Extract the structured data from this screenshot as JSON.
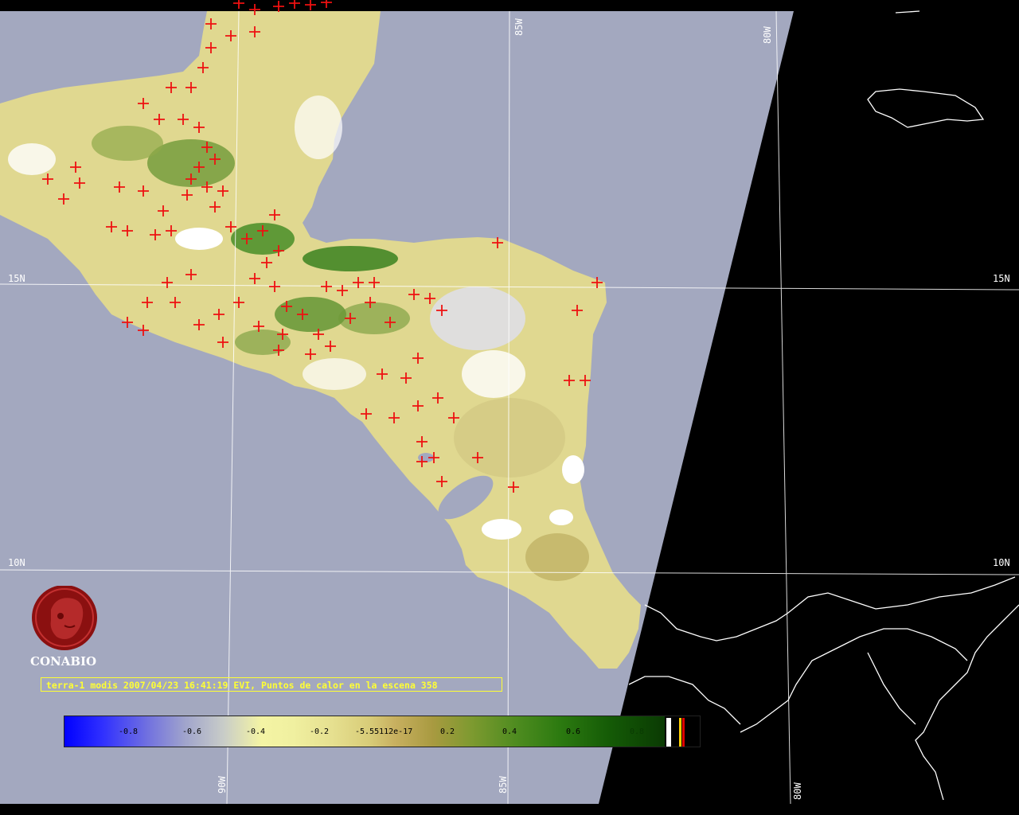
{
  "latitude_labels": {
    "lat15_left": "15N",
    "lat15_right": "15N",
    "lat10_left": "10N",
    "lat10_right": "10N"
  },
  "longitude_labels": {
    "lon85_top": "85W",
    "lon80_top": "80W",
    "lon90_bottom": "90W",
    "lon85_bottom": "85W",
    "lon80_bottom": "80W"
  },
  "logo": {
    "text": "CONABIO"
  },
  "caption": {
    "text": "terra-1 modis 2007/04/23 16:41:19 EVI, Puntos de calor en la escena 358"
  },
  "colorbar": {
    "ticks": [
      "-0.8",
      "-0.6",
      "-0.4",
      "-0.2",
      "-5.55112e-17",
      "0.2",
      "0.4",
      "0.6",
      "0.8"
    ],
    "colors": {
      "min": "#0000ff",
      "mid": "#f4f4a4",
      "max": "#0a3a03"
    }
  },
  "colors": {
    "ocean": "#a3a8bf",
    "land_dry": "#e0d890",
    "land_green": "#2f7d18",
    "hotspot": "#ee1111",
    "no_data": "#000000",
    "grid": "#ffffff"
  }
}
